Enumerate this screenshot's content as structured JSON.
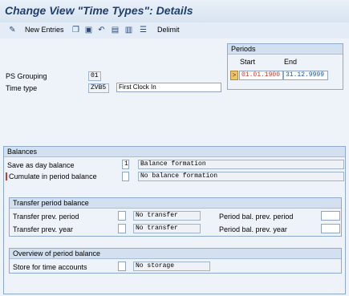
{
  "window": {
    "title": "Change View \"Time Types\": Details"
  },
  "toolbar": {
    "new_entries_label": "New Entries",
    "delimit_label": "Delimit",
    "icons": [
      "glasses-pen-icon",
      "copy-icon",
      "delete-icon",
      "undo-icon",
      "prev-entry-icon",
      "next-entry-icon",
      "variable-list-icon"
    ]
  },
  "periods": {
    "header": "Periods",
    "start_label": "Start",
    "end_label": "End",
    "start_value": "01.01.1900",
    "end_value": "31.12.9999"
  },
  "keys": {
    "ps_grouping_label": "PS Grouping",
    "ps_grouping_value": "01",
    "time_type_label": "Time type",
    "time_type_value": "ZVB5",
    "time_type_text": "First Clock In"
  },
  "balances": {
    "header": "Balances",
    "save_day_label": "Save as day balance",
    "save_day_value": "1",
    "save_day_text": "Balance formation",
    "cumulate_label": "Cumulate in period balance",
    "cumulate_value": "",
    "cumulate_text": "No balance formation"
  },
  "transfer": {
    "header": "Transfer period balance",
    "prev_period_label": "Transfer prev. period",
    "prev_period_text": "No transfer",
    "prev_year_label": "Transfer prev. year",
    "prev_year_text": "No transfer",
    "bal_prev_period_label": "Period bal. prev. period",
    "bal_prev_year_label": "Period bal. prev. year"
  },
  "overview": {
    "header": "Overview of period balance",
    "store_label": "Store for time accounts",
    "store_text": "No storage"
  },
  "colors": {
    "title": "#1f3f6f",
    "start_date": "#c0392b",
    "end_date": "#1f4f8f"
  }
}
